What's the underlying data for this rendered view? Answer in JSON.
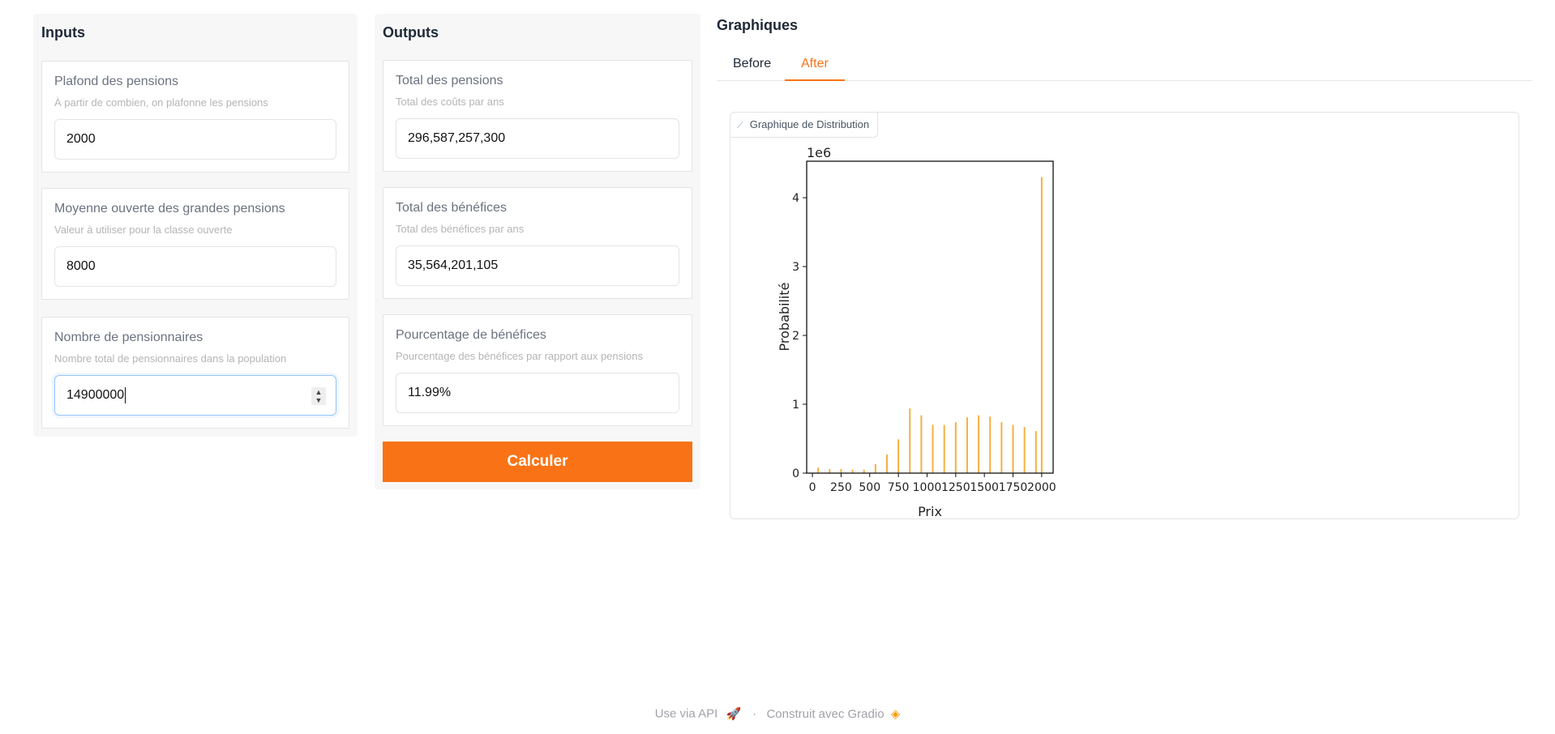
{
  "inputs": {
    "title": "Inputs",
    "fields": [
      {
        "label": "Plafond des pensions",
        "info": "À partir de combien, on plafonne les pensions",
        "value": "2000"
      },
      {
        "label": "Moyenne ouverte des grandes pensions",
        "info": "Valeur à utiliser pour la classe ouverte",
        "value": "8000"
      },
      {
        "label": "Nombre de pensionnaires",
        "info": "Nombre total de pensionnaires dans la population",
        "value": "14900000"
      }
    ]
  },
  "outputs": {
    "title": "Outputs",
    "fields": [
      {
        "label": "Total des pensions",
        "info": "Total des coûts par ans",
        "value": "296,587,257,300"
      },
      {
        "label": "Total des bénéfices",
        "info": "Total des bénéfices par ans",
        "value": "35,564,201,105"
      },
      {
        "label": "Pourcentage de bénéfices",
        "info": "Pourcentage des bénéfices par rapport aux pensions",
        "value": "11.99%"
      }
    ],
    "button": "Calculer"
  },
  "graphs": {
    "title": "Graphiques",
    "tabs": [
      "Before",
      "After"
    ],
    "active_tab": "After",
    "plot_label": "Graphique de Distribution"
  },
  "chart_data": {
    "type": "bar",
    "xlabel": "Prix",
    "ylabel": "Probabilité",
    "y_offset_label": "1e6",
    "bar_color": "#f5b041",
    "x": [
      50,
      150,
      250,
      350,
      450,
      550,
      650,
      750,
      850,
      950,
      1050,
      1150,
      1250,
      1350,
      1450,
      1550,
      1650,
      1750,
      1850,
      1950,
      2000
    ],
    "values": [
      80000,
      60000,
      60000,
      50000,
      50000,
      130000,
      270000,
      490000,
      940000,
      840000,
      700000,
      700000,
      740000,
      810000,
      840000,
      820000,
      740000,
      700000,
      670000,
      610000,
      4300000
    ],
    "xlim": [
      -50,
      2100
    ],
    "ylim": [
      0,
      4530000
    ],
    "xticks": [
      "0",
      "250",
      "500",
      "750",
      "1000",
      "1250",
      "1500",
      "1750",
      "2000"
    ],
    "yticks": [
      "0",
      "1",
      "2",
      "3",
      "4"
    ],
    "grid": false
  },
  "footer": {
    "api": "Use via API",
    "sep": "·",
    "built": "Construit avec Gradio"
  },
  "colors": {
    "accent": "#f97316"
  }
}
